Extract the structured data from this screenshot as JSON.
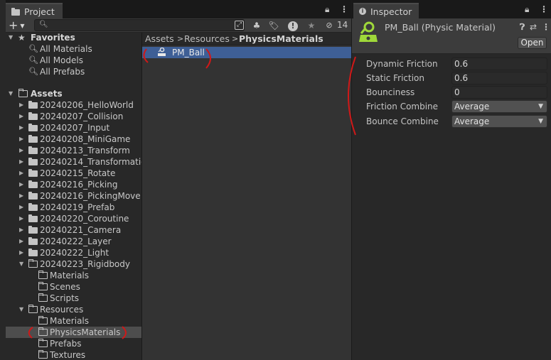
{
  "project": {
    "tab_title": "Project",
    "search": {
      "value": "",
      "placeholder": ""
    },
    "hidden_count": "14",
    "favorites": {
      "label": "Favorites",
      "items": [
        "All Materials",
        "All Models",
        "All Prefabs"
      ]
    },
    "assets_label": "Assets",
    "folders": [
      "20240206_HelloWorld",
      "20240207_Collision",
      "20240207_Input",
      "20240208_MiniGame",
      "20240213_Transform",
      "20240214_Transformatio",
      "20240215_Rotate",
      "20240216_Picking",
      "20240216_PickingMove",
      "20240219_Prefab",
      "20240220_Coroutine",
      "20240221_Camera",
      "20240222_Layer",
      "20240222_Light"
    ],
    "rigidbody": {
      "label": "20240223_Rigidbody",
      "children": [
        "Materials",
        "Scenes",
        "Scripts"
      ]
    },
    "resources": {
      "label": "Resources",
      "children": [
        "Materials",
        "PhysicsMaterials",
        "Prefabs",
        "Textures"
      ]
    },
    "breadcrumb": [
      "Assets",
      "Resources",
      "PhysicsMaterials"
    ],
    "asset_item": "PM_Ball"
  },
  "inspector": {
    "tab_title": "Inspector",
    "title": "PM_Ball (Physic Material)",
    "open_label": "Open",
    "properties": [
      {
        "label": "Dynamic Friction",
        "value": "0.6"
      },
      {
        "label": "Static Friction",
        "value": "0.6"
      },
      {
        "label": "Bounciness",
        "value": "0"
      }
    ],
    "dropdowns": [
      {
        "label": "Friction Combine",
        "value": "Average"
      },
      {
        "label": "Bounce Combine",
        "value": "Average"
      }
    ]
  },
  "colors": {
    "selection": "#3e5f96",
    "icon_green": "#9fd83a",
    "annotation_red": "#d01818"
  }
}
